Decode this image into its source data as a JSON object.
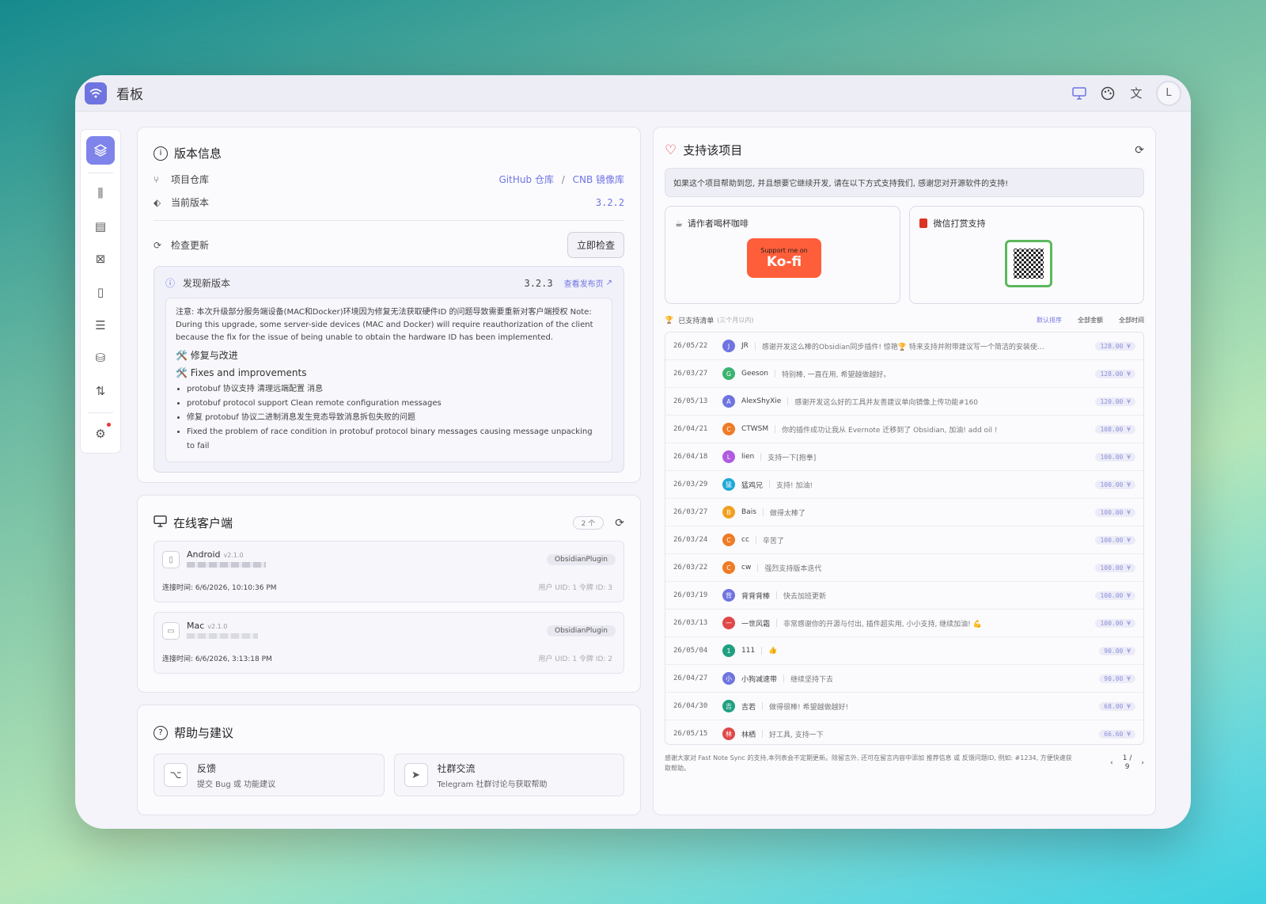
{
  "app": {
    "title": "看板",
    "avatar_initial": "L"
  },
  "version_card": {
    "title": "版本信息",
    "repo_label": "项目仓库",
    "repo_links": [
      "GitHub 仓库",
      "/",
      "CNB 镜像库"
    ],
    "current_label": "当前版本",
    "current_version": "3.2.2",
    "check_label": "检查更新",
    "check_button": "立即检查",
    "new_version_label": "发现新版本",
    "new_version": "3.2.3",
    "release_link": "查看发布页",
    "note": "注意: 本次升级部分服务端设备(MAC和Docker)环境因为修复无法获取硬件ID 的问题导致需要重新对客户端授权 Note: During this upgrade, some server-side devices (MAC and Docker) will require reauthorization of the client because the fix for the issue of being unable to obtain the hardware ID has been implemented.",
    "heading_cn": "🛠️ 修复与改进",
    "heading_en": "🛠️ Fixes and improvements",
    "items": [
      "protobuf 协议支持 清理远端配置 消息",
      "protobuf protocol support Clean remote configuration messages",
      "修复 protobuf 协议二进制消息发生竞态导致消息拆包失败的问题",
      "Fixed the problem of race condition in protobuf protocol binary messages causing message unpacking to fail"
    ]
  },
  "clients_card": {
    "title": "在线客户端",
    "count": "2 个",
    "clients": [
      {
        "name": "Android",
        "version": "v2.1.0",
        "plugin": "ObsidianPlugin",
        "conn": "连接时间: 6/6/2026, 10:10:36 PM",
        "uid": "用户 UID: 1   令牌 ID: 3"
      },
      {
        "name": "Mac",
        "version": "v2.1.0",
        "plugin": "ObsidianPlugin",
        "conn": "连接时间: 6/6/2026, 3:13:18 PM",
        "uid": "用户 UID: 1   令牌 ID: 2"
      }
    ]
  },
  "help_card": {
    "title": "帮助与建议",
    "items": [
      {
        "title": "反馈",
        "sub": "提交 Bug 或 功能建议"
      },
      {
        "title": "社群交流",
        "sub": "Telegram 社群讨论与获取帮助"
      }
    ]
  },
  "support_card": {
    "title": "支持该项目",
    "desc": "如果这个项目帮助到您, 并且想要它继续开发, 请在以下方式支持我们, 感谢您对开源软件的支持!",
    "coffee_title": "请作者喝杯咖啡",
    "kofi_top": "Support me on",
    "kofi_main": "Ko-fi",
    "wechat_title": "微信打赏支持",
    "list_title": "已支持清单",
    "list_sub": "(三个月以内)",
    "sort_default": "默认排序",
    "sort_amount": "全部金额",
    "sort_time": "全部时间",
    "rows": [
      {
        "date": "26/05/22",
        "initial": "J",
        "color": "#6f74e0",
        "name": "JR",
        "msg": "感谢开发这么棒的Obsidian同步插件! 惊艳🏆 特来支持并附带建议写一个简洁的安装使…",
        "amount": "128.00 ¥"
      },
      {
        "date": "26/03/27",
        "initial": "G",
        "color": "#3cb371",
        "name": "Geeson",
        "msg": "特别棒, 一直在用, 希望越做越好。",
        "amount": "128.00 ¥"
      },
      {
        "date": "26/05/13",
        "initial": "A",
        "color": "#6f74e0",
        "name": "AlexShyXie",
        "msg": "感谢开发这么好的工具并友善建议单向镜像上传功能#160",
        "amount": "120.00 ¥"
      },
      {
        "date": "26/04/21",
        "initial": "C",
        "color": "#f07b24",
        "name": "CTWSM",
        "msg": "你的插件成功让我从 Evernote 迁移到了 Obsidian, 加油! add oil !",
        "amount": "108.00 ¥"
      },
      {
        "date": "26/04/18",
        "initial": "L",
        "color": "#b05be0",
        "name": "lien",
        "msg": "支持一下[抱拳]",
        "amount": "100.00 ¥"
      },
      {
        "date": "26/03/29",
        "initial": "猛",
        "color": "#1fa8d8",
        "name": "猛鸡兄",
        "msg": "支持! 加油!",
        "amount": "100.00 ¥"
      },
      {
        "date": "26/03/27",
        "initial": "B",
        "color": "#f0a020",
        "name": "Bais",
        "msg": "做得太棒了",
        "amount": "100.00 ¥"
      },
      {
        "date": "26/03/24",
        "initial": "C",
        "color": "#f07b24",
        "name": "cc",
        "msg": "辛苦了",
        "amount": "100.00 ¥"
      },
      {
        "date": "26/03/22",
        "initial": "C",
        "color": "#f07b24",
        "name": "cw",
        "msg": "强烈支持版本迭代",
        "amount": "100.00 ¥"
      },
      {
        "date": "26/03/19",
        "initial": "背",
        "color": "#6f74e0",
        "name": "背背背棒",
        "msg": "快去加班更新",
        "amount": "100.00 ¥"
      },
      {
        "date": "26/03/13",
        "initial": "一",
        "color": "#e04848",
        "name": "一世风霜",
        "msg": "非常感谢你的开源与付出, 插件超实用, 小小支持, 继续加油! 💪",
        "amount": "100.00 ¥"
      },
      {
        "date": "26/05/04",
        "initial": "1",
        "color": "#20a080",
        "name": "111",
        "msg": "👍",
        "amount": "90.00 ¥"
      },
      {
        "date": "26/04/27",
        "initial": "小",
        "color": "#6f74e0",
        "name": "小狗减速带",
        "msg": "继续坚持下去",
        "amount": "90.00 ¥"
      },
      {
        "date": "26/04/30",
        "initial": "吉",
        "color": "#20a080",
        "name": "吉若",
        "msg": "做得很棒! 希望越做越好!",
        "amount": "68.00 ¥"
      },
      {
        "date": "26/05/15",
        "initial": "林",
        "color": "#e04848",
        "name": "林栖",
        "msg": "好工具, 支持一下",
        "amount": "66.60 ¥"
      }
    ],
    "footer": "感谢大家对 Fast Note Sync 的支持,本列表会不定期更新。除留言外, 还可在留言内容中添加 推荐信息 或 反馈问题ID, 例如: #1234, 方便快速获取帮助。",
    "page": "1 /",
    "pages": "9"
  },
  "colors": {
    "accent": "#6f74e0",
    "kofi": "#ff5e3a"
  }
}
